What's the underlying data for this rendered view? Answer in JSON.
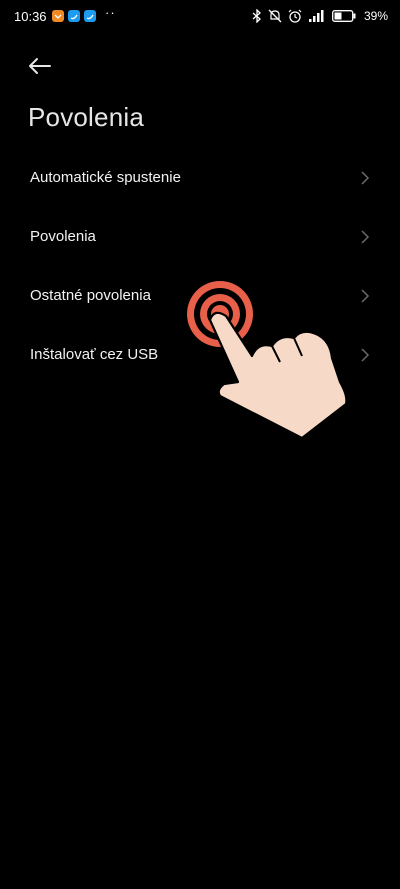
{
  "status_bar": {
    "time": "10:36",
    "battery_percent": "39%",
    "icons": [
      "mail-notif-icon",
      "twitter-icon",
      "twitter-icon",
      "bluetooth-icon",
      "mute-icon",
      "alarm-icon",
      "signal-icon",
      "battery-icon"
    ]
  },
  "header": {
    "title": "Povolenia"
  },
  "list": {
    "items": [
      {
        "label": "Automatické spustenie"
      },
      {
        "label": "Povolenia"
      },
      {
        "label": "Ostatné povolenia"
      },
      {
        "label": "Inštalovať cez USB"
      }
    ]
  },
  "colors": {
    "background": "#000000",
    "text": "#f2f2f2",
    "chevron": "#6a6a6a",
    "tap_ring": "#e8604a",
    "hand_skin": "#f7d9c8"
  }
}
